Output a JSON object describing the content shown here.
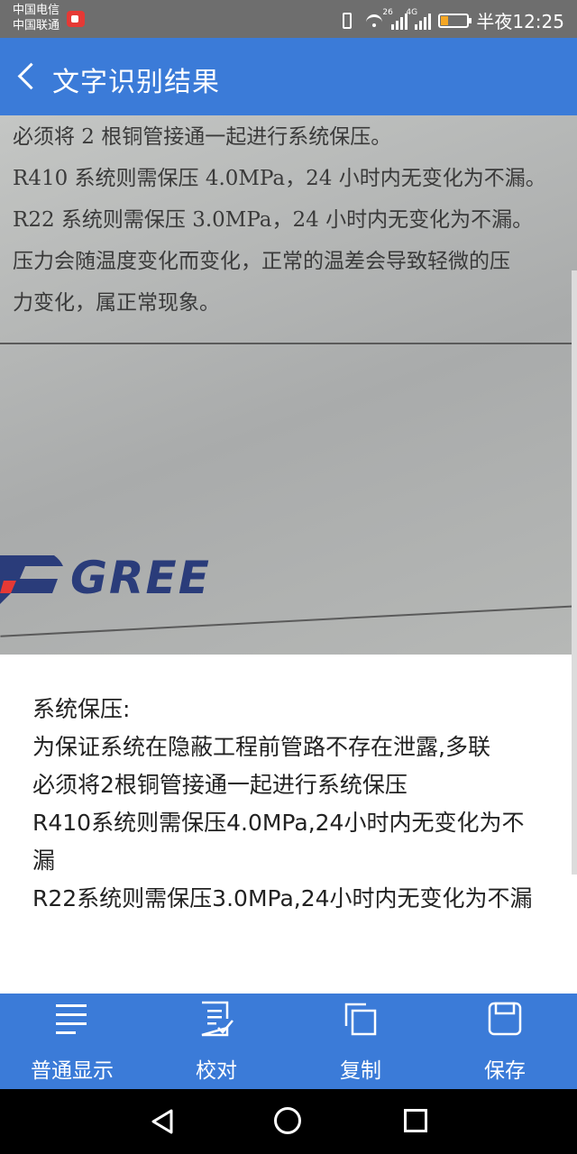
{
  "status_bar": {
    "carrier1": "中国电信",
    "carrier2": "中国联通",
    "net1": "26",
    "net2": "4G",
    "time": "半夜12:25"
  },
  "app_bar": {
    "title": "文字识别结果"
  },
  "photo": {
    "lines": [
      "必须将 2 根铜管接通一起进行系统保压。",
      "R410 系统则需保压 4.0MPa，24 小时内无变化为不漏。",
      "R22 系统则需保压 3.0MPa，24 小时内无变化为不漏。",
      "压力会随温度变化而变化，正常的温差会导致轻微的压",
      "力变化，属正常现象。"
    ],
    "logo_text": "GREE"
  },
  "result": {
    "lines": [
      "系统保压:",
      "为保证系统在隐蔽工程前管路不存在泄露,多联",
      "必须将2根铜管接通一起进行系统保压",
      "R410系统则需保压4.0MPa,24小时内无变化为不漏",
      "R22系统则需保压3.0MPa,24小时内无变化为不漏"
    ]
  },
  "toolbar": {
    "items": [
      {
        "label": "普通显示",
        "icon": "list-icon"
      },
      {
        "label": "校对",
        "icon": "proofread-icon"
      },
      {
        "label": "复制",
        "icon": "copy-icon"
      },
      {
        "label": "保存",
        "icon": "save-icon"
      }
    ]
  },
  "colors": {
    "accent": "#3b7bd8",
    "status_bar": "#6e6e6e"
  }
}
